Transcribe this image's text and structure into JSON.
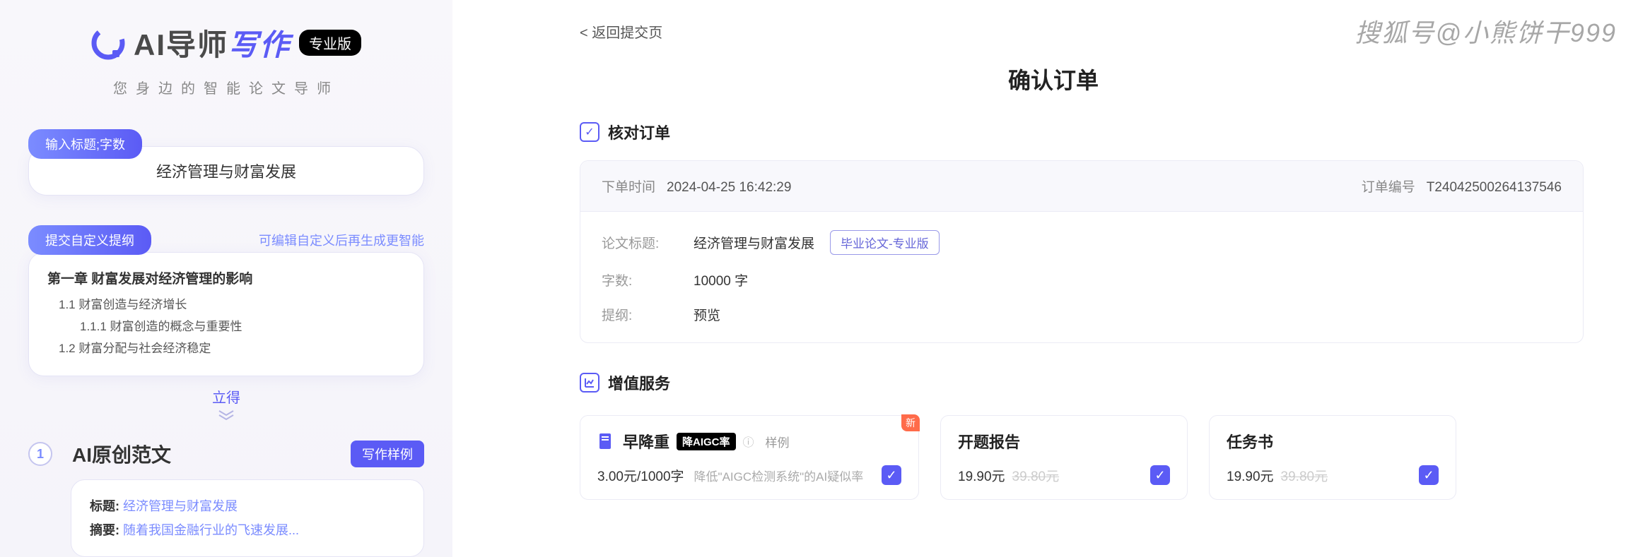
{
  "watermark": "搜狐号@小熊饼干999",
  "left": {
    "logo_main": "AI导师",
    "logo_accent": "写作",
    "pro_badge": "专业版",
    "tagline": "您身边的智能论文导师",
    "input_section": "输入标题;字数",
    "topic_value": "经济管理与财富发展",
    "outline_section": "提交自定义提纲",
    "outline_hint": "可编辑自定义后再生成更智能",
    "outline": {
      "h1": "第一章 财富发展对经济管理的影响",
      "items": [
        "1.1 财富创造与经济增长",
        "1.1.1 财富创造的概念与重要性",
        "1.2 财富分配与社会经济稳定"
      ]
    },
    "lide": "立得",
    "step_num": "1",
    "step_title": "AI原创范文",
    "sample_btn": "写作样例",
    "sample": {
      "title_label": "标题:",
      "title_value": "经济管理与财富发展",
      "abstract_label": "摘要:",
      "abstract_value": "随着我国金融行业的飞速发展..."
    }
  },
  "right": {
    "back": "< 返回提交页",
    "page_title": "确认订单",
    "verify_title": "核对订单",
    "order_time_label": "下单时间",
    "order_time": "2024-04-25 16:42:29",
    "order_no_label": "订单编号",
    "order_no": "T24042500264137546",
    "rows": {
      "topic_k": "论文标题:",
      "topic_v": "经济管理与财富发展",
      "type_badge": "毕业论文-专业版",
      "words_k": "字数:",
      "words_v": "10000 字",
      "outline_k": "提纲:",
      "outline_v": "预览"
    },
    "services_title": "增值服务",
    "svc1": {
      "brand": "早降重",
      "aigc": "降AIGC率",
      "sample": "样例",
      "new": "新",
      "price": "3.00元/1000字",
      "desc": "降低\"AIGC检测系统\"的AI疑似率"
    },
    "svc2": {
      "title": "开题报告",
      "price": "19.90元",
      "old": "39.80元"
    },
    "svc3": {
      "title": "任务书",
      "price": "19.90元",
      "old": "39.80元"
    }
  }
}
